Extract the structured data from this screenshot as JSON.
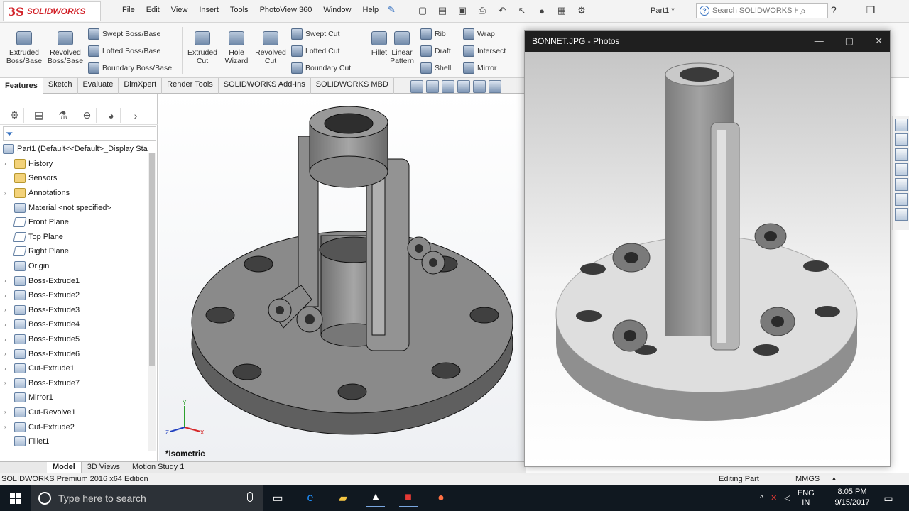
{
  "app": {
    "brand_ds": "3S",
    "brand_name": "SOLIDWORKS",
    "doc_title": "Part1 *"
  },
  "menu": [
    "File",
    "Edit",
    "View",
    "Insert",
    "Tools",
    "PhotoView 360",
    "Window",
    "Help"
  ],
  "search": {
    "placeholder": "Search SOLIDWORKS Help"
  },
  "commands": {
    "extruded_boss": "Extruded\nBoss/Base",
    "revolved_boss": "Revolved\nBoss/Base",
    "swept_boss": "Swept Boss/Base",
    "lofted_boss": "Lofted Boss/Base",
    "boundary_boss": "Boundary Boss/Base",
    "extruded_cut": "Extruded\nCut",
    "hole_wizard": "Hole\nWizard",
    "revolved_cut": "Revolved\nCut",
    "swept_cut": "Swept Cut",
    "lofted_cut": "Lofted Cut",
    "boundary_cut": "Boundary Cut",
    "fillet": "Fillet",
    "linear_pattern": "Linear\nPattern",
    "rib": "Rib",
    "draft": "Draft",
    "shell": "Shell",
    "wrap": "Wrap",
    "intersect": "Intersect",
    "mirror": "Mirror"
  },
  "tabs": [
    "Features",
    "Sketch",
    "Evaluate",
    "DimXpert",
    "Render Tools",
    "SOLIDWORKS Add-Ins",
    "SOLIDWORKS MBD"
  ],
  "tree": {
    "root": "Part1  (Default<<Default>_Display Sta",
    "items": [
      {
        "label": "History",
        "exp": "›"
      },
      {
        "label": "Sensors",
        "exp": ""
      },
      {
        "label": "Annotations",
        "exp": "›"
      },
      {
        "label": "Material <not specified>",
        "exp": ""
      },
      {
        "label": "Front Plane",
        "exp": ""
      },
      {
        "label": "Top Plane",
        "exp": ""
      },
      {
        "label": "Right Plane",
        "exp": ""
      },
      {
        "label": "Origin",
        "exp": ""
      },
      {
        "label": "Boss-Extrude1",
        "exp": "›"
      },
      {
        "label": "Boss-Extrude2",
        "exp": "›"
      },
      {
        "label": "Boss-Extrude3",
        "exp": "›"
      },
      {
        "label": "Boss-Extrude4",
        "exp": "›"
      },
      {
        "label": "Boss-Extrude5",
        "exp": "›"
      },
      {
        "label": "Boss-Extrude6",
        "exp": "›"
      },
      {
        "label": "Cut-Extrude1",
        "exp": "›"
      },
      {
        "label": "Boss-Extrude7",
        "exp": "›"
      },
      {
        "label": "Mirror1",
        "exp": ""
      },
      {
        "label": "Cut-Revolve1",
        "exp": "›"
      },
      {
        "label": "Cut-Extrude2",
        "exp": "›"
      },
      {
        "label": "Fillet1",
        "exp": ""
      }
    ]
  },
  "viewport": {
    "view_label": "*Isometric"
  },
  "bottom_tabs": [
    "Model",
    "3D Views",
    "Motion Study 1"
  ],
  "status": {
    "edition": "SOLIDWORKS Premium 2016 x64 Edition",
    "mode": "Editing Part",
    "units": "MMGS"
  },
  "photos": {
    "title": "BONNET.JPG - Photos"
  },
  "taskbar": {
    "search_placeholder": "Type here to search",
    "lang1": "ENG",
    "lang2": "IN",
    "time": "8:05 PM",
    "date": "9/15/2017"
  }
}
